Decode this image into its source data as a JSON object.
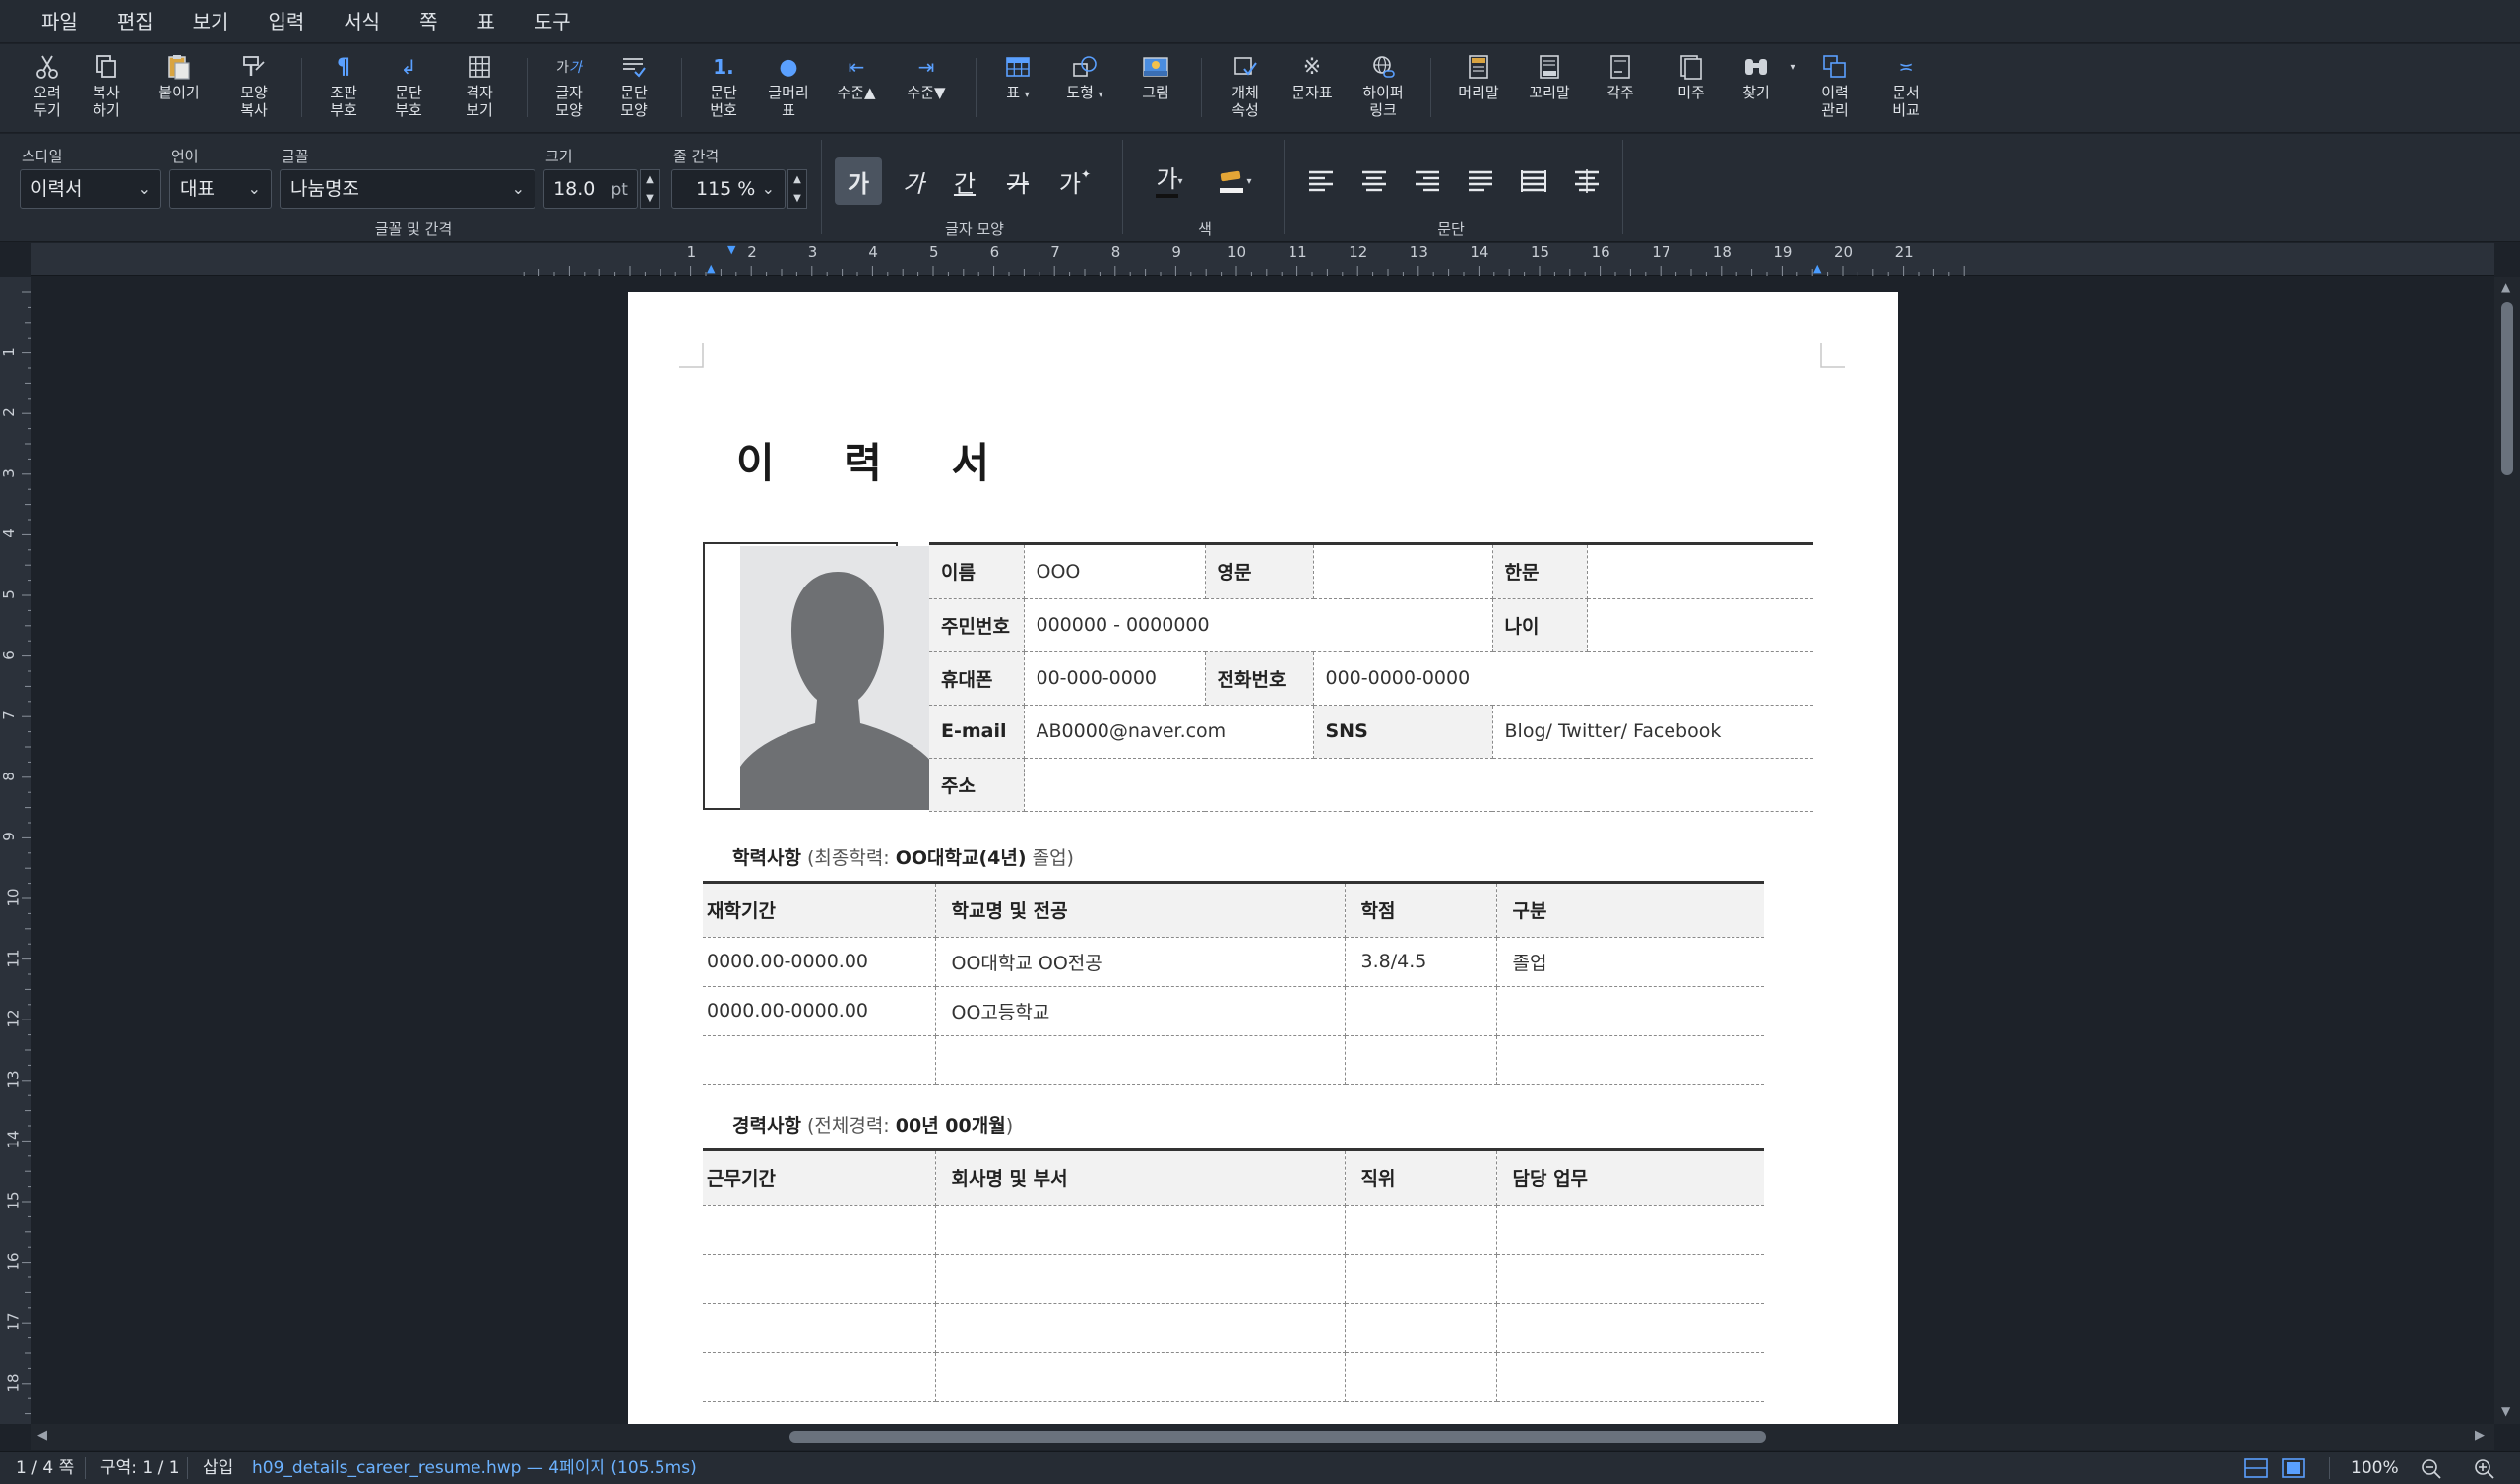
{
  "menu": [
    "파일",
    "편집",
    "보기",
    "입력",
    "서식",
    "쪽",
    "표",
    "도구"
  ],
  "toolbar": {
    "cut": "오려\n두기",
    "copy": "복사\n하기",
    "paste": "붙이기",
    "format_copy": "모양\n복사",
    "layout_marks": "조판\n부호",
    "para_marks": "문단\n부호",
    "grid_view": "격자\n보기",
    "char_shape": "글자\n모양",
    "para_shape": "문단\n모양",
    "para_number": "문단\n번호",
    "bullet": "글머리\n표",
    "level_up": "수준▲",
    "level_down": "수준▼",
    "table": "표",
    "shape": "도형",
    "picture": "그림",
    "object_props": "개체\n속성",
    "symbols": "문자표",
    "hyperlink": "하이퍼\n링크",
    "header": "머리말",
    "footer": "꼬리말",
    "footnote": "각주",
    "endnote": "미주",
    "find": "찾기",
    "history": "이력\n관리",
    "compare": "문서\n비교"
  },
  "formatbar": {
    "style_label": "스타일",
    "style_value": "이력서",
    "lang_label": "언어",
    "lang_value": "대표",
    "font_label": "글꼴",
    "font_value": "나눔명조",
    "size_label": "크기",
    "size_value": "18.0",
    "size_unit": "pt",
    "spacing_label": "줄 간격",
    "spacing_value": "115 %",
    "group_font": "글꼴 및 간격",
    "group_char": "글자 모양",
    "group_color": "색",
    "group_para": "문단",
    "btn_bold": "가",
    "btn_italic": "가",
    "btn_underline": "간",
    "btn_strike": "가",
    "btn_more": "가",
    "btn_color": "가"
  },
  "ruler": {
    "h": [
      "1",
      "2",
      "3",
      "4",
      "5",
      "6",
      "7",
      "8",
      "9",
      "10",
      "11",
      "12",
      "13",
      "14",
      "15",
      "16",
      "17",
      "18",
      "19",
      "20",
      "21"
    ],
    "v": [
      "1",
      "2",
      "3",
      "4",
      "5",
      "6",
      "7",
      "8",
      "9",
      "10",
      "11",
      "12",
      "13",
      "14",
      "15",
      "16",
      "17",
      "18"
    ]
  },
  "doc": {
    "title": "이 력 서",
    "info": {
      "name_label": "이름",
      "name_value": "OOO",
      "eng_label": "영문",
      "eng_value": "",
      "han_label": "한문",
      "han_value": "",
      "rrn_label": "주민번호",
      "rrn_value": "000000  -  0000000",
      "age_label": "나이",
      "age_value": "",
      "mobile_label": "휴대폰",
      "mobile_value": "00-000-0000",
      "phone_label": "전화번호",
      "phone_value": "000-0000-0000",
      "email_label": "E-mail",
      "email_value": "AB0000@naver.com",
      "sns_label": "SNS",
      "sns_value": "Blog/  Twitter/  Facebook",
      "addr_label": "주소",
      "addr_value": ""
    },
    "edu": {
      "title": "학력사항",
      "summary_prefix": "(최종학력: ",
      "summary_value": "OO대학교(4년)",
      "summary_suffix": " 졸업)",
      "headers": [
        "재학기간",
        "학교명 및 전공",
        "학점",
        "구분"
      ],
      "rows": [
        [
          "0000.00-0000.00",
          "OO대학교  OO전공",
          "3.8/4.5",
          "졸업"
        ],
        [
          "0000.00-0000.00",
          "OO고등학교",
          "",
          ""
        ],
        [
          "",
          "",
          "",
          ""
        ]
      ]
    },
    "career": {
      "title": "경력사항",
      "summary_prefix": "(전체경력: ",
      "summary_value": "00년 00개월",
      "summary_suffix": ")",
      "headers": [
        "근무기간",
        "회사명 및 부서",
        "직위",
        "담당 업무"
      ],
      "rows": [
        [
          "",
          "",
          "",
          ""
        ],
        [
          "",
          "",
          "",
          ""
        ],
        [
          "",
          "",
          "",
          ""
        ],
        [
          "",
          "",
          "",
          ""
        ]
      ]
    }
  },
  "status": {
    "page": "1 / 4 쪽",
    "section": "구역: 1 / 1",
    "mode": "삽입",
    "file": "h09_details_career_resume.hwp — 4페이지 (105.5ms)",
    "zoom": "100%"
  }
}
